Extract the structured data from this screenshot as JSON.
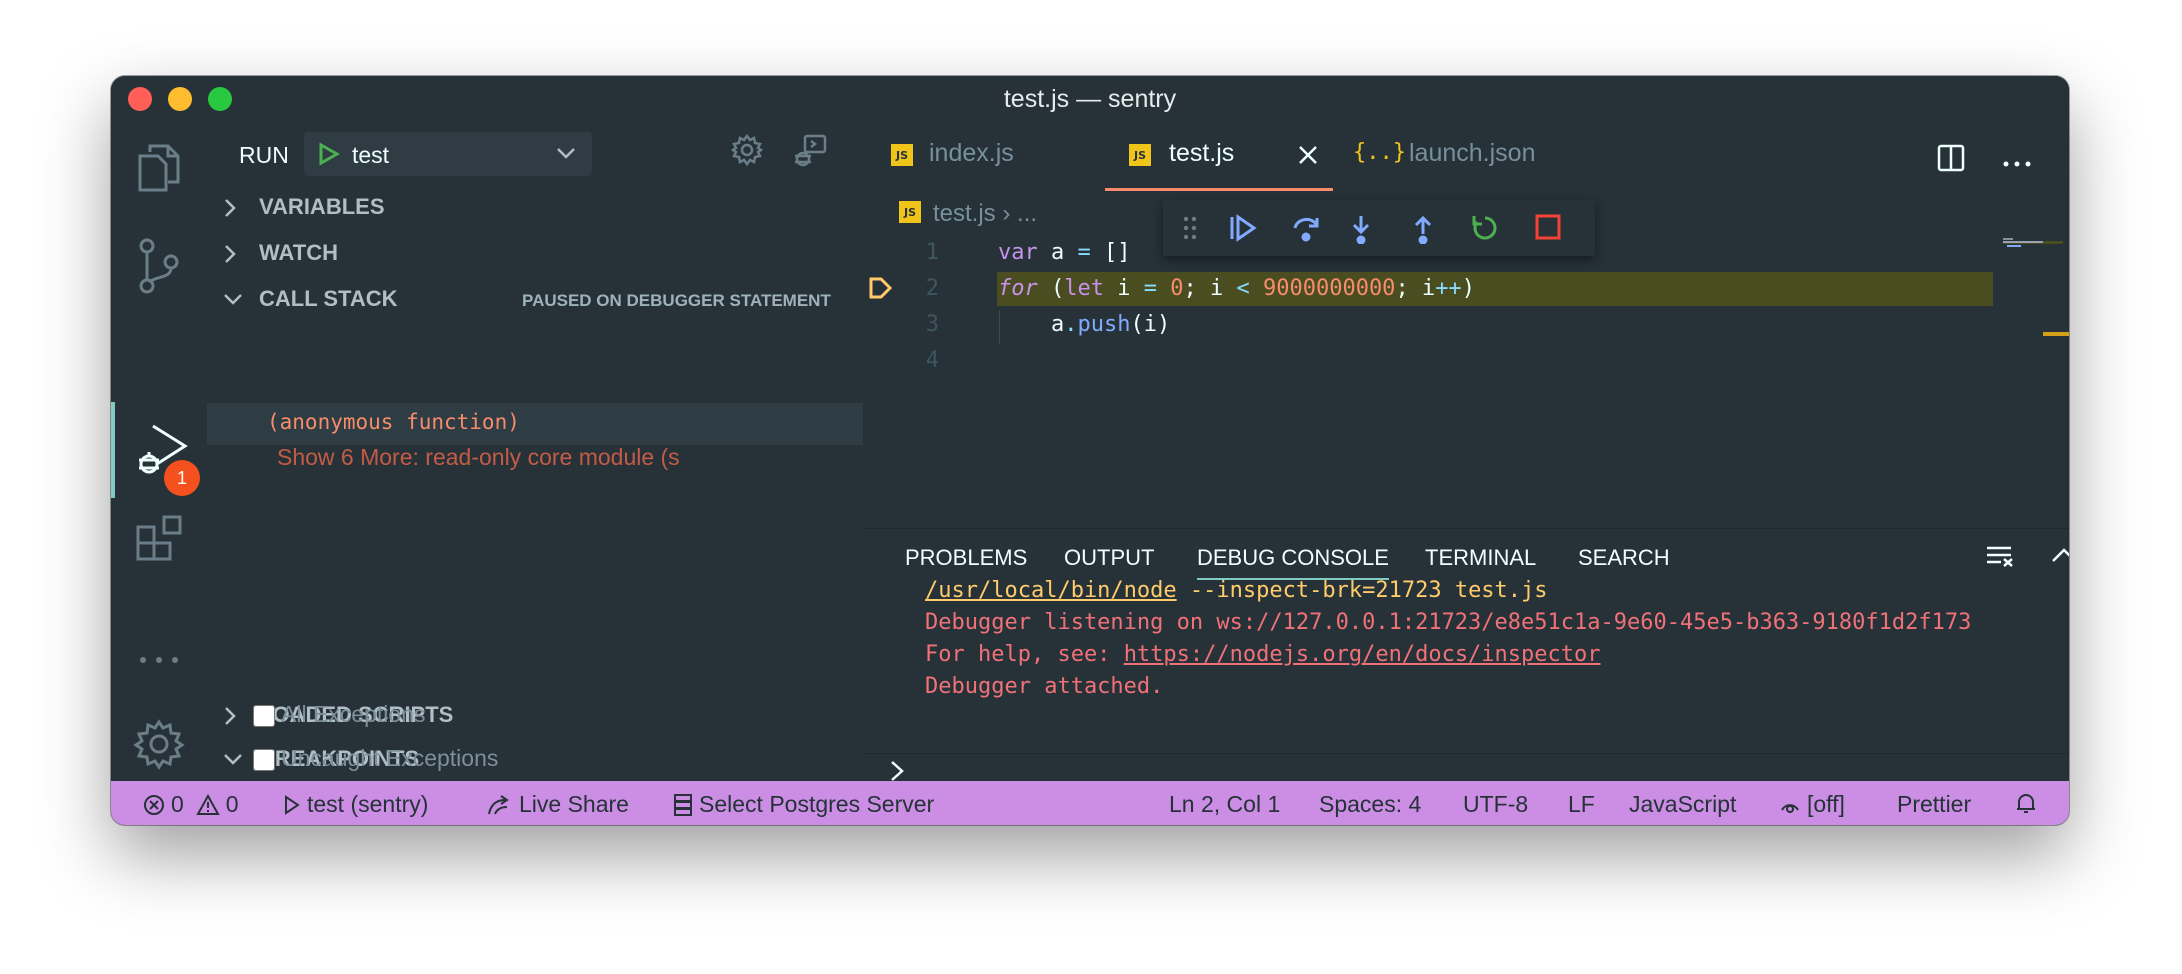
{
  "window": {
    "title": "test.js — sentry"
  },
  "activity_bar": {
    "debug_badge": "1"
  },
  "sidebar": {
    "run_label": "RUN",
    "config_name": "test",
    "sections": {
      "variables": "VARIABLES",
      "watch": "WATCH",
      "call_stack": "CALL STACK",
      "call_stack_status": "PAUSED ON DEBUGGER STATEMENT",
      "loaded_scripts": "LOADED SCRIPTS",
      "breakpoints": "BREAKPOINTS"
    },
    "call_stack_frames": [
      "(anonymous function)"
    ],
    "show_more": "Show 6 More: read-only core module (s",
    "breakpoint_items": [
      "All Exceptions",
      "Uncaught Exceptions"
    ]
  },
  "editor": {
    "tabs": [
      {
        "label": "index.js",
        "type": "js",
        "active": false
      },
      {
        "label": "test.js",
        "type": "js",
        "active": true
      },
      {
        "label": "launch.json",
        "type": "json",
        "active": false
      }
    ],
    "breadcrumb": {
      "file": "test.js",
      "separator": "›",
      "rest": "..."
    },
    "line_numbers": [
      "1",
      "2",
      "3",
      "4"
    ],
    "code": {
      "line1": {
        "var": "var",
        "name": " a ",
        "eq": "=",
        "val": " []"
      },
      "line2": {
        "for": "for",
        "p1": " (",
        "let": "let",
        "i1": " i ",
        "eq": "=",
        "zero": " 0",
        "semi1": "; i ",
        "lt": "<",
        "big": " 9000000000",
        "semi2": "; i",
        "inc": "++",
        "close": ")"
      },
      "line3": {
        "indent": "    a",
        "dot": ".",
        "push": "push",
        "args": "(i)"
      }
    }
  },
  "panel": {
    "tabs": [
      "PROBLEMS",
      "OUTPUT",
      "DEBUG CONSOLE",
      "TERMINAL",
      "SEARCH"
    ],
    "active_tab": "DEBUG CONSOLE",
    "console": {
      "node_path": "/usr/local/bin/node",
      "node_args": " --inspect-brk=21723 test.js",
      "listening": "Debugger listening on ws://127.0.0.1:21723/e8e51c1a-9e60-45e5-b363-9180f1d2f173",
      "help_prefix": "For help, see: ",
      "help_url": "https://nodejs.org/en/docs/inspector",
      "attached": "Debugger attached."
    }
  },
  "statusbar": {
    "errors": "0",
    "warnings": "0",
    "debug_target": "test (sentry)",
    "live_share": "Live Share",
    "postgres": "Select Postgres Server",
    "position": "Ln 2, Col 1",
    "spaces": "Spaces: 4",
    "encoding": "UTF-8",
    "eol": "LF",
    "language": "JavaScript",
    "watch_status": "[off]",
    "formatter": "Prettier"
  },
  "colors": {
    "background": "#263238",
    "accent": "#80cbc4",
    "status_bar": "#cb8ee4",
    "active_tab_border": "#f78c6c",
    "current_line": "#4a4d20"
  }
}
